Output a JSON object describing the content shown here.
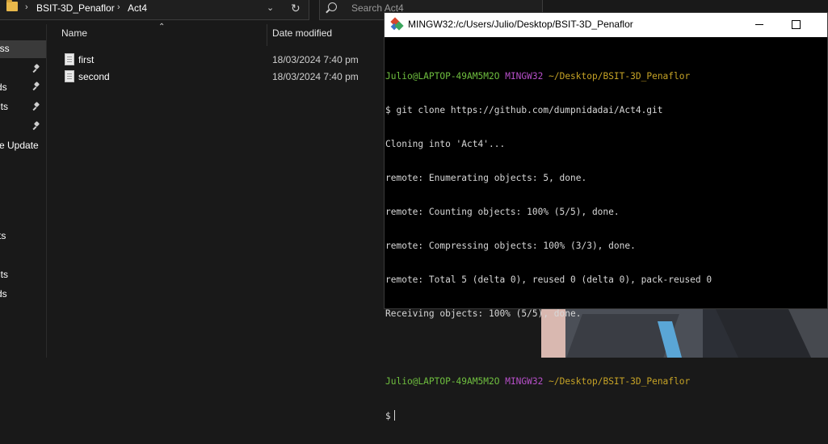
{
  "explorer": {
    "breadcrumb": [
      "BSIT-3D_Penaflor",
      "Act4"
    ],
    "search_placeholder": "Search Act4",
    "nav_items": [
      "ess",
      "ds",
      "nts",
      "e Update",
      "ts",
      "nts",
      "ds"
    ],
    "columns": {
      "name": "Name",
      "date_modified": "Date modified"
    },
    "files": [
      {
        "name": "first",
        "date": "18/03/2024 7:40 pm"
      },
      {
        "name": "second",
        "date": "18/03/2024 7:40 pm"
      }
    ]
  },
  "terminal": {
    "title": "MINGW32:/c/Users/Julio/Desktop/BSIT-3D_Penaflor",
    "prompt": {
      "user": "Julio@LAPTOP-49AM5M2O",
      "system": "MINGW32",
      "path": "~/Desktop/BSIT-3D_Penaflor"
    },
    "lines": [
      "$ git clone https://github.com/dumpnidadai/Act4.git",
      "Cloning into 'Act4'...",
      "remote: Enumerating objects: 5, done.",
      "remote: Counting objects: 100% (5/5), done.",
      "remote: Compressing objects: 100% (3/3), done.",
      "remote: Total 5 (delta 0), reused 0 (delta 0), pack-reused 0",
      "Receiving objects: 100% (5/5), done."
    ],
    "input_prompt": "$"
  }
}
